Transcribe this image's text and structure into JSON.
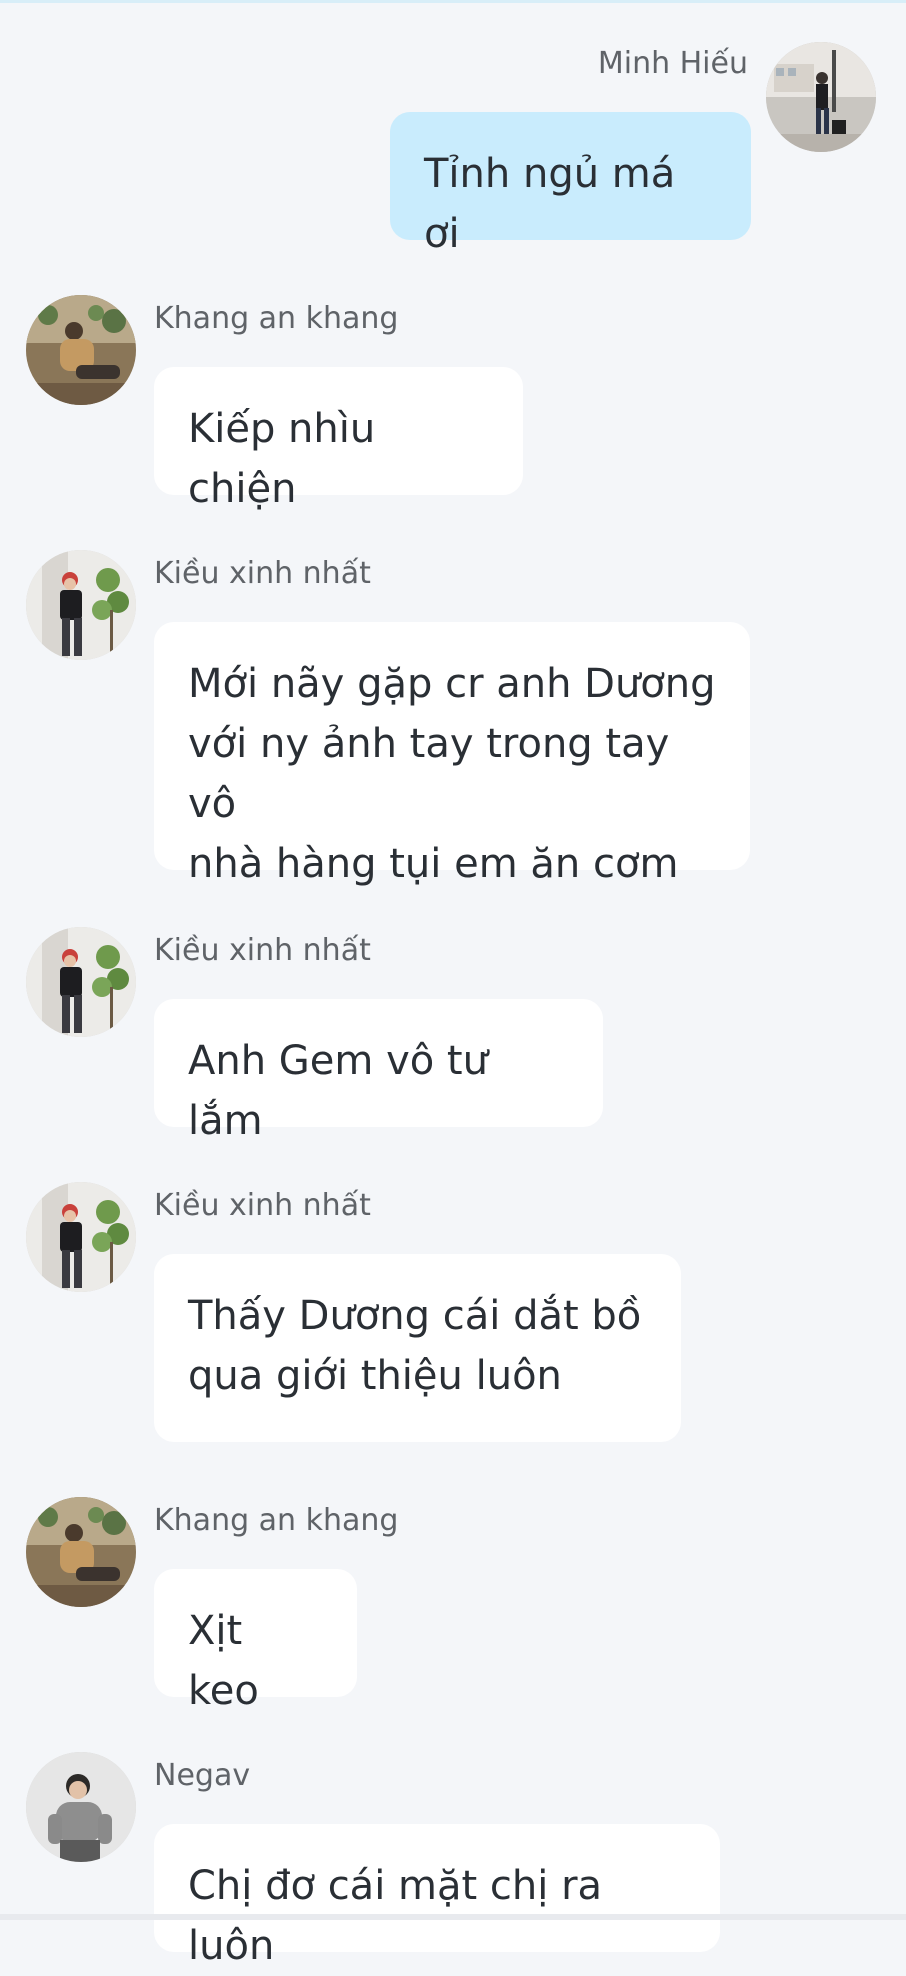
{
  "messages": [
    {
      "sender": "Minh Hiếu",
      "text": "Tỉnh ngủ má ơi",
      "avatar_icon": "avatar-traveler-icon",
      "own": true
    },
    {
      "sender": "Khang an khang",
      "text": "Kiếp nhìu chiện",
      "avatar_icon": "avatar-sitting-man-icon",
      "own": false
    },
    {
      "sender": "Kiều xinh nhất",
      "text": "Mới nãy gặp cr anh Dương\nvới ny ảnh tay trong tay vô\nnhà hàng tụi em ăn cơm",
      "avatar_icon": "avatar-red-hair-icon",
      "own": false
    },
    {
      "sender": "Kiều xinh nhất",
      "text": "Anh Gem vô tư lắm",
      "avatar_icon": "avatar-red-hair-icon",
      "own": false
    },
    {
      "sender": "Kiều xinh nhất",
      "text": "Thấy Dương cái dắt bồ\nqua giới thiệu luôn",
      "avatar_icon": "avatar-red-hair-icon",
      "own": false
    },
    {
      "sender": "Khang an khang",
      "text": "Xịt keo",
      "avatar_icon": "avatar-sitting-man-icon",
      "own": false
    },
    {
      "sender": "Negav",
      "text": "Chị đơ cái mặt chị ra luôn",
      "avatar_icon": "avatar-gray-sweater-icon",
      "own": false
    }
  ],
  "colors": {
    "background": "#f4f6f9",
    "own_bubble": "#c9ecfd",
    "other_bubble": "#ffffff",
    "name_text": "#5f6368",
    "message_text": "#2a2f35"
  }
}
